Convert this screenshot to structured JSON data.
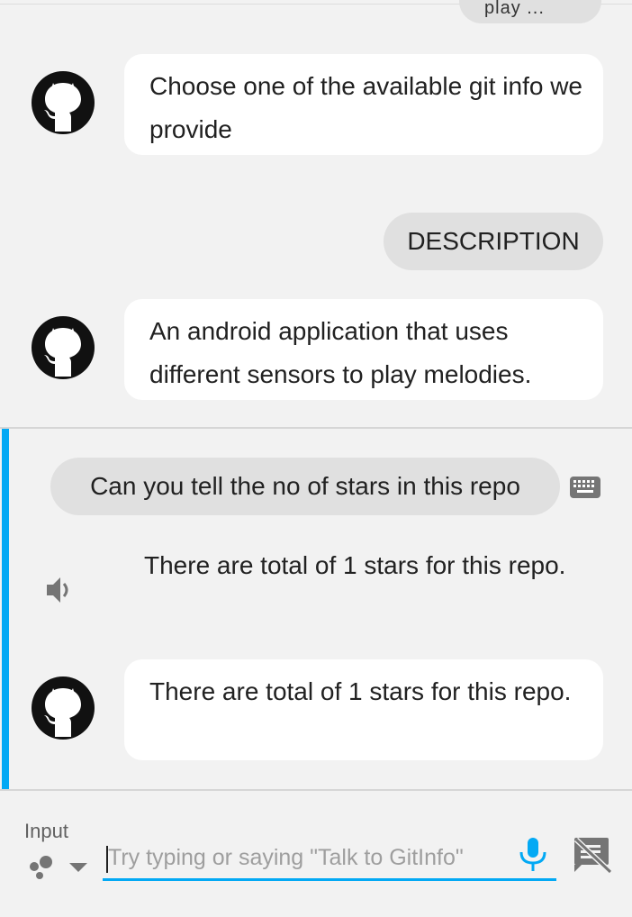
{
  "colors": {
    "accent": "#03a9f4",
    "bubble_bot": "#ffffff",
    "bubble_user": "#e0e0e0",
    "background": "#f2f2f2"
  },
  "history": {
    "previous_user_chip_partial": "play ...",
    "bot_message_1": "Choose one of the available git info we provide",
    "user_chip_description": "DESCRIPTION",
    "bot_message_2": "An android application that uses different sensors to play melodies."
  },
  "current": {
    "user_query": "Can you tell the no of stars in this repo",
    "spoken_response": "There are total of 1 stars for this repo.",
    "bot_message": "There are total of 1 stars for this repo."
  },
  "input": {
    "label": "Input",
    "placeholder": "Try typing or saying \"Talk to GitInfo\""
  },
  "icons": {
    "avatar": "github-icon",
    "keyboard": "keyboard-icon",
    "speaker": "volume-icon",
    "assistant": "assistant-dots-icon",
    "dropdown": "caret-down-icon",
    "mic": "microphone-icon",
    "no_display": "no-display-icon"
  }
}
